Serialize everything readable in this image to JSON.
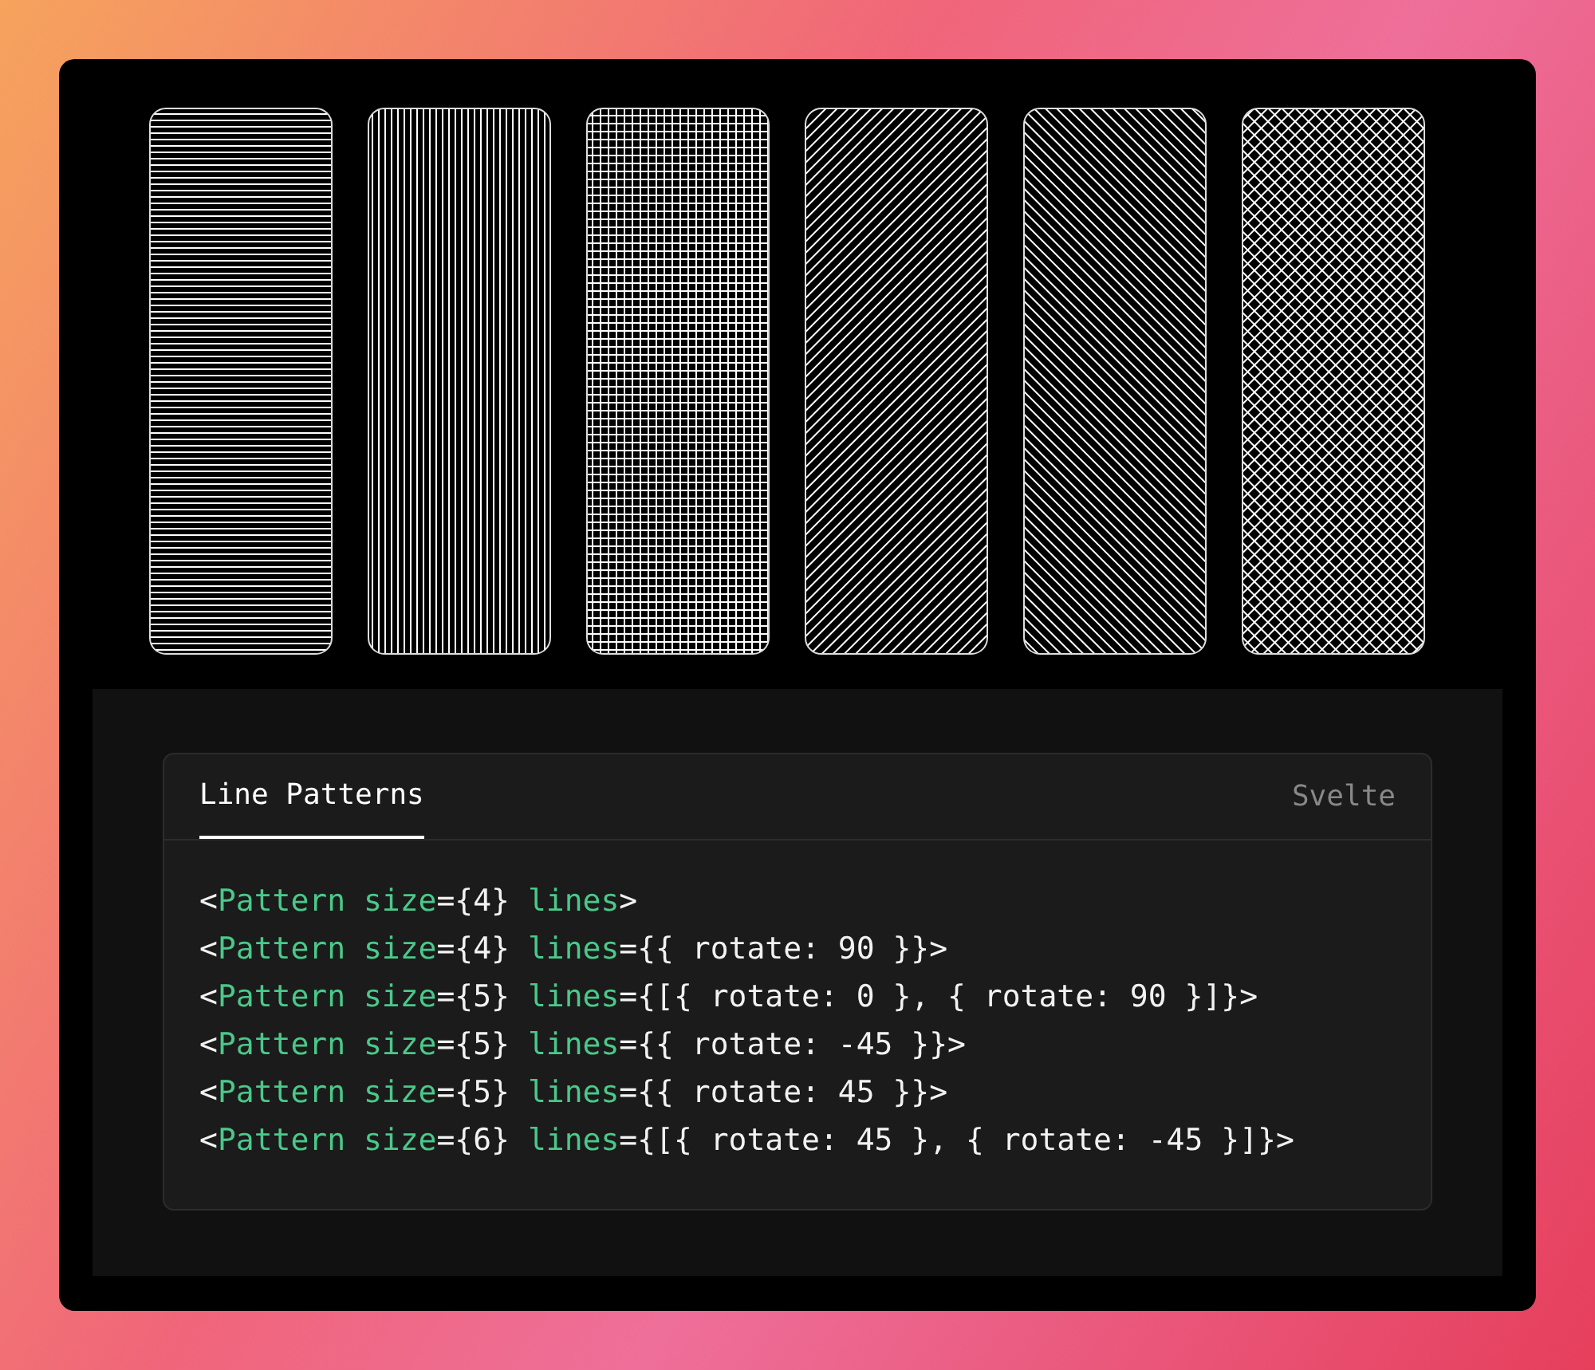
{
  "patterns": [
    {
      "kind": "horizontal"
    },
    {
      "kind": "vertical"
    },
    {
      "kind": "grid"
    },
    {
      "kind": "diagonal-up"
    },
    {
      "kind": "diagonal-down"
    },
    {
      "kind": "crosshatch"
    }
  ],
  "code_panel": {
    "tabs": [
      {
        "label": "Line Patterns",
        "selected": true
      }
    ],
    "language": "Svelte",
    "lines": [
      [
        {
          "kind": "punct",
          "text": "<"
        },
        {
          "kind": "name",
          "text": "Pattern size"
        },
        {
          "kind": "punct",
          "text": "={4} "
        },
        {
          "kind": "name",
          "text": "lines"
        },
        {
          "kind": "punct",
          "text": ">"
        }
      ],
      [
        {
          "kind": "punct",
          "text": "<"
        },
        {
          "kind": "name",
          "text": "Pattern size"
        },
        {
          "kind": "punct",
          "text": "={4} "
        },
        {
          "kind": "name",
          "text": "lines"
        },
        {
          "kind": "punct",
          "text": "={{ rotate: 90 }}>"
        }
      ],
      [
        {
          "kind": "punct",
          "text": "<"
        },
        {
          "kind": "name",
          "text": "Pattern size"
        },
        {
          "kind": "punct",
          "text": "={5} "
        },
        {
          "kind": "name",
          "text": "lines"
        },
        {
          "kind": "punct",
          "text": "={[{ rotate: 0 }, { rotate: 90 }]}>"
        }
      ],
      [
        {
          "kind": "punct",
          "text": "<"
        },
        {
          "kind": "name",
          "text": "Pattern size"
        },
        {
          "kind": "punct",
          "text": "={5} "
        },
        {
          "kind": "name",
          "text": "lines"
        },
        {
          "kind": "punct",
          "text": "={{ rotate: -45 }}>"
        }
      ],
      [
        {
          "kind": "punct",
          "text": "<"
        },
        {
          "kind": "name",
          "text": "Pattern size"
        },
        {
          "kind": "punct",
          "text": "={5} "
        },
        {
          "kind": "name",
          "text": "lines"
        },
        {
          "kind": "punct",
          "text": "={{ rotate: 45 }}>"
        }
      ],
      [
        {
          "kind": "punct",
          "text": "<"
        },
        {
          "kind": "name",
          "text": "Pattern size"
        },
        {
          "kind": "punct",
          "text": "={6} "
        },
        {
          "kind": "name",
          "text": "lines"
        },
        {
          "kind": "punct",
          "text": "={[{ rotate: 45 }, { rotate: -45 }]}>"
        }
      ]
    ]
  }
}
